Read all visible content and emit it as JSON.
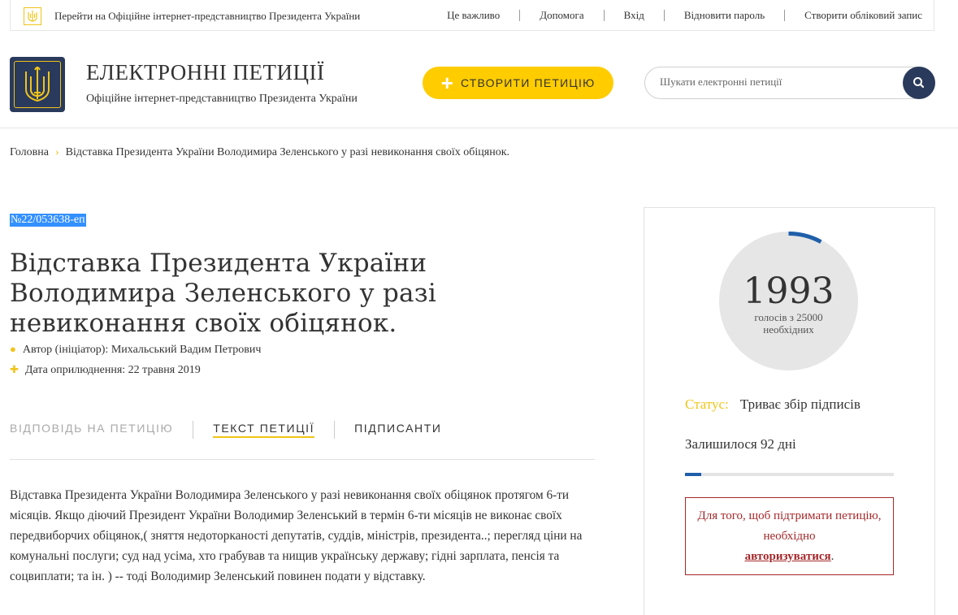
{
  "topbar": {
    "official_link": "Перейти на Офіційне інтернет-представництво Президента України",
    "nav": [
      "Це важливо",
      "Допомога",
      "Вхід",
      "Відновити пароль",
      "Створити обліковий запис"
    ]
  },
  "header": {
    "title": "ЕЛЕКТРОННІ ПЕТИЦІЇ",
    "subtitle": "Офіційне інтернет-представництво Президента України",
    "create_button": "СТВОРИТИ ПЕТИЦІЮ",
    "search_placeholder": "Шукати електронні петиції"
  },
  "breadcrumb": {
    "home": "Головна",
    "current": "Відставка Президента України Володимира Зеленського у разі невиконання своїх обіцянок."
  },
  "petition": {
    "id": "№22/053638-еп",
    "title": "Відставка Президента України Володимира Зеленського у разі невиконання своїх обіцянок.",
    "author": "Автор (ініціатор): Михальський Вадим Петрович",
    "date": "Дата оприлюднення: 22 травня 2019",
    "tabs": [
      "ВІДПОВІДЬ НА ПЕТИЦІЮ",
      "ТЕКСТ ПЕТИЦІЇ",
      "ПІДПИСАНТИ"
    ],
    "text": "Відставка Президента України Володимира Зеленського у разі невиконання своїх обіцянок протягом 6-ти місяців. Якщо діючий Президент України Володимир Зеленський в термін 6-ти місяців не виконає своїх передвиборчих обіцянок,( зняття недоторканості депутатів, суддів, міністрів, президента..; перегляд ціни на комунальні послуги; суд над усіма, хто грабував та нищив українську державу; гідні зарплата, пенсія та соцвиплати; та ін. ) -- тоді Володимир Зеленський повинен подати у відставку."
  },
  "stats": {
    "votes": "1993",
    "votes_sub_1": "голосів з 25000",
    "votes_sub_2": "необхідних",
    "progress_fraction": 0.0797,
    "status_label": "Статус:",
    "status_value": "Триває збір підписів",
    "remaining": "Залишилося 92 дні",
    "auth_text": "Для того, щоб підтримати петицію, необхідно",
    "auth_link": "авторизуватися",
    "auth_end": "."
  },
  "colors": {
    "accent": "#ffcc00",
    "navy": "#2a3a5c",
    "progress": "#1f5faa",
    "alert": "#a5282a"
  }
}
